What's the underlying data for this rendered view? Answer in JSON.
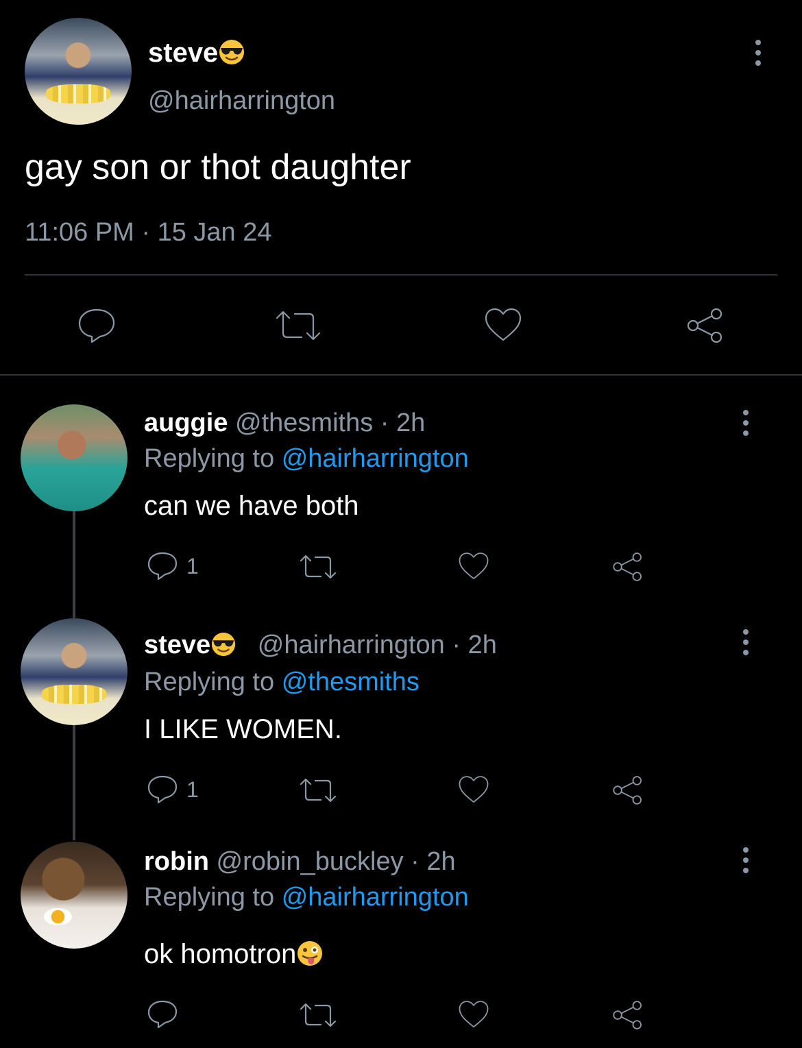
{
  "main_tweet": {
    "display_name": "steve",
    "name_emoji": "sunglasses-emoji",
    "handle": "@hairharrington",
    "text": "gay son or thot daughter",
    "timestamp": "11:06 PM · 15 Jan 24"
  },
  "replies": [
    {
      "display_name": "auggie",
      "handle": "@thesmiths",
      "time": "· 2h",
      "replying_prefix": "Replying to",
      "replying_to": "@hairharrington",
      "text": "can we have both",
      "reply_count": "1"
    },
    {
      "display_name": "steve",
      "name_emoji": "sunglasses-emoji",
      "handle": "@hairharrington",
      "time": "· 2h",
      "replying_prefix": "Replying to",
      "replying_to": "@thesmiths",
      "text": "I LIKE WOMEN.",
      "reply_count": "1"
    },
    {
      "display_name": "robin",
      "handle": "@robin_buckley",
      "time": "· 2h",
      "replying_prefix": "Replying to",
      "replying_to": "@hairharrington",
      "text": "ok homotron",
      "text_emoji": "winking-tongue-emoji",
      "reply_count": ""
    }
  ],
  "colors": {
    "background": "#000000",
    "muted": "#8b98a5",
    "link": "#1d9bf0",
    "divider": "#2f3336"
  }
}
